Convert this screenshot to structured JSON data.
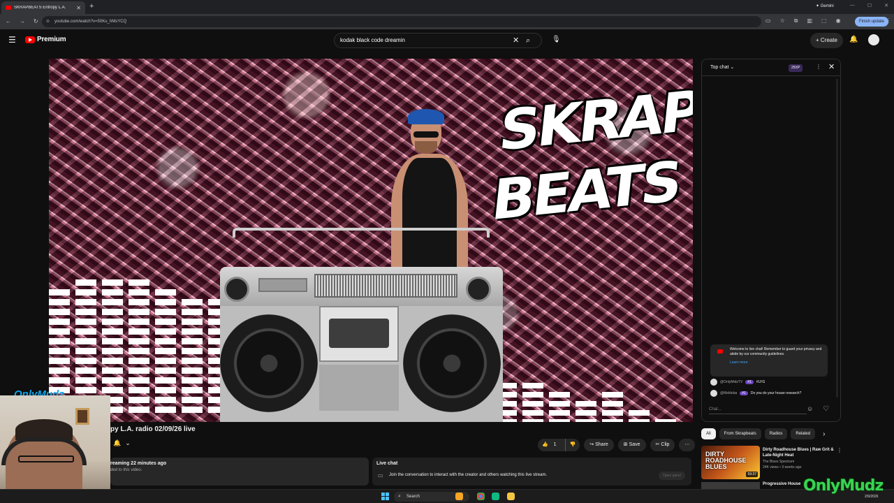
{
  "browser": {
    "tab_title": "SKRAPBEATS Entropy L.A.",
    "url": "youtube.com/watch?v=50Ku_hMsYCQ",
    "gemini_label": "Gemini",
    "finish_update": "Finish update"
  },
  "masthead": {
    "logo_text": "Premium",
    "search_query": "kodak black code dreamin",
    "create_label": "Create"
  },
  "player": {
    "logo_art": "SKRAP BEATS",
    "overlay_brand": "OnlyMudz"
  },
  "video": {
    "title": "py L.A. radio 02/09/26 live",
    "like_count": "1",
    "share_label": "Share",
    "save_label": "Save",
    "clip_label": "Clip"
  },
  "description": {
    "line1": "reaming 22 minutes ago",
    "line2": "ded to this video."
  },
  "live_chat_card": {
    "heading": "Live chat",
    "text": "Join the conversation to interact with the creator and others watching this live stream.",
    "open_panel": "Open panel"
  },
  "chat": {
    "mode": "Top chat",
    "xp": "25XP",
    "welcome": "Welcome to live chat! Remember to guard your privacy and abide by our community guidelines.",
    "learn_more": "Learn more",
    "messages": [
      {
        "author": "@OnlyMidzTV",
        "badge": "#1",
        "text": "#LFG"
      },
      {
        "author": "@Meldoba",
        "badge": "#1",
        "text": "Do you do your house research?"
      }
    ],
    "input_placeholder": "Chat..."
  },
  "chips": [
    "All",
    "From Skrapbeats",
    "Radios",
    "Related"
  ],
  "recommendations": [
    {
      "thumb_text": "DIRTY ROADHOUSE BLUES",
      "duration": "59:37",
      "title": "Dirty Roadhouse Blues | Raw Grit & Late-Night Heat",
      "channel": "The Blues Spectrum",
      "meta": "24K views • 3 weeks ago"
    },
    {
      "title": "Progressive House"
    }
  ],
  "taskbar": {
    "search_label": "Search"
  },
  "watermark": {
    "text": "OnlyMudz",
    "date": "2/9/2026"
  }
}
